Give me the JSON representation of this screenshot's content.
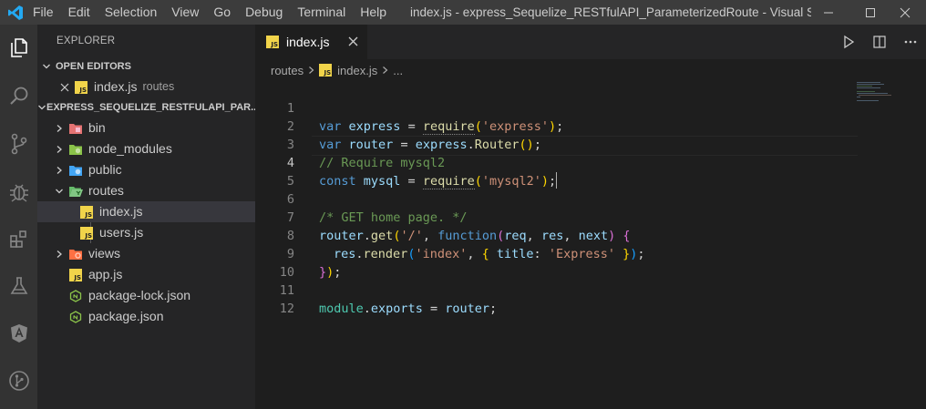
{
  "titlebar": {
    "menu": [
      "File",
      "Edit",
      "Selection",
      "View",
      "Go",
      "Debug",
      "Terminal",
      "Help"
    ],
    "window_title": "index.js - express_Sequelize_RESTfulAPI_ParameterizedRoute - Visual Studio C..."
  },
  "activity_bar": {
    "icons": [
      "files-icon",
      "search-icon",
      "source-control-icon",
      "debug-icon",
      "extensions-icon",
      "test-flask-icon",
      "angular-icon",
      "git-graph-icon"
    ]
  },
  "sidebar": {
    "title": "EXPLORER",
    "open_editors": {
      "header": "OPEN EDITORS",
      "items": [
        {
          "name": "index.js",
          "description": "routes"
        }
      ]
    },
    "project": {
      "header": "EXPRESS_SEQUELIZE_RESTFULAPI_PAR...",
      "tree": [
        {
          "name": "bin",
          "kind": "folder"
        },
        {
          "name": "node_modules",
          "kind": "folder"
        },
        {
          "name": "public",
          "kind": "folder"
        },
        {
          "name": "routes",
          "kind": "folder-open"
        },
        {
          "name": "index.js",
          "kind": "js"
        },
        {
          "name": "users.js",
          "kind": "js"
        },
        {
          "name": "views",
          "kind": "folder"
        },
        {
          "name": "app.js",
          "kind": "js"
        },
        {
          "name": "package-lock.json",
          "kind": "node"
        },
        {
          "name": "package.json",
          "kind": "node"
        }
      ]
    }
  },
  "editor": {
    "tab": {
      "label": "index.js",
      "badge": "JS"
    },
    "breadcrumb": {
      "folder": "routes",
      "file": "index.js",
      "symbol": "..."
    },
    "line_numbers": [
      "1",
      "2",
      "3",
      "4",
      "5",
      "6",
      "7",
      "8",
      "9",
      "10",
      "11",
      "12"
    ],
    "code": {
      "l1": {
        "kw": "var",
        "name": "express",
        "eq": " = ",
        "fn": "require",
        "open": "(",
        "arg": "'express'",
        "close": ")",
        "end": ";"
      },
      "l2": {
        "kw": "var",
        "name": "router",
        "eq": " = ",
        "obj": "express",
        "dot": ".",
        "fn": "Router",
        "open": "(",
        "close": ")",
        "end": ";"
      },
      "l3": {
        "comment": "// Require mysql2"
      },
      "l4": {
        "kw": "const",
        "name": "mysql",
        "eq": " = ",
        "fn": "require",
        "open": "(",
        "arg": "'mysql2'",
        "close": ")",
        "end": ";"
      },
      "l6": {
        "comment": "/* GET home page. */"
      },
      "l7": {
        "obj": "router",
        "dot": ".",
        "fn": "get",
        "open": "(",
        "arg": "'/'",
        "comma": ", ",
        "kw": "function",
        "p_open": "(",
        "p1": "req",
        "sep1": ", ",
        "p2": "res",
        "sep2": ", ",
        "p3": "next",
        "p_close": ")",
        "brace": " {"
      },
      "l8": {
        "obj": "res",
        "dot": ".",
        "fn": "render",
        "open": "(",
        "arg": "'index'",
        "comma": ", ",
        "brace_open": "{",
        "key": " title",
        "colon": ": ",
        "val": "'Express'",
        "brace_close": " }",
        "close": ")",
        "end": ";"
      },
      "l9": {
        "brace": "}",
        "close": ")",
        "end": ";"
      },
      "l11": {
        "obj": "module",
        "dot": ".",
        "prop": "exports",
        "eq": " = ",
        "name": "router",
        "end": ";"
      }
    }
  },
  "colors": {
    "titlebar": "#3c3c3c",
    "activitybar": "#333333",
    "sidebar": "#252526",
    "editor": "#1e1e1e",
    "vscode_blue": "#23a9f2",
    "js_badge": "#f1d44a"
  }
}
